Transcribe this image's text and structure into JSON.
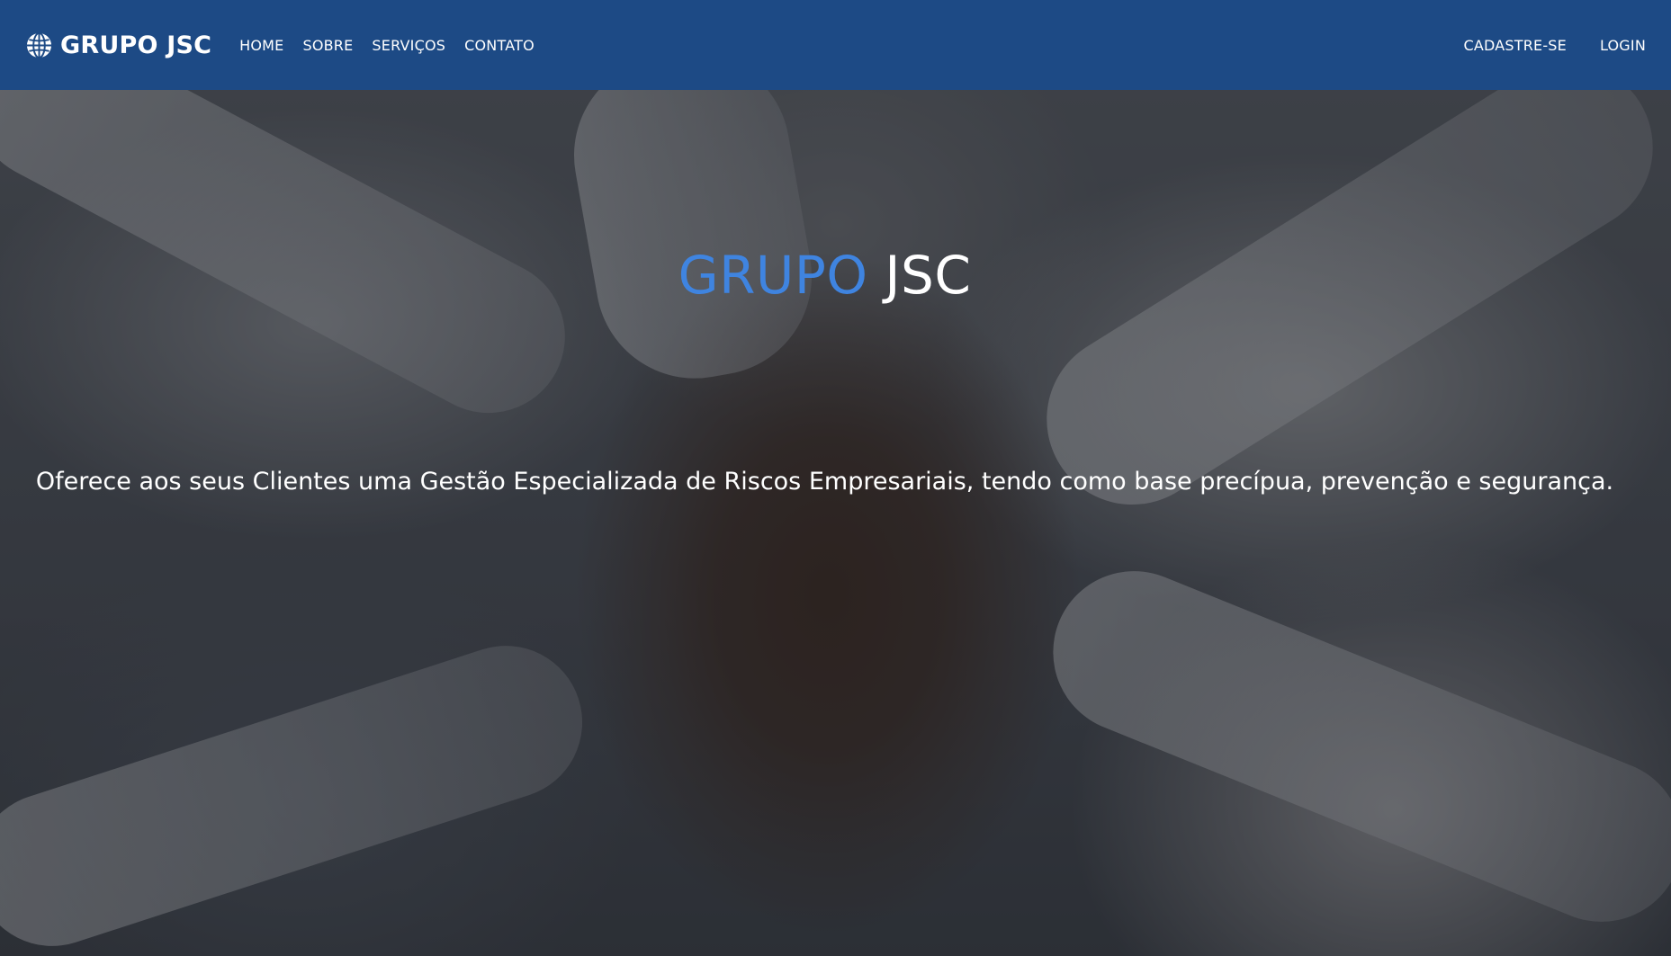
{
  "navbar": {
    "brand": "GRUPO JSC",
    "brand_icon": "globe-icon",
    "left_links": [
      "HOME",
      "SOBRE",
      "SERVIÇOS",
      "CONTATO"
    ],
    "right_links": [
      "CADASTRE-SE",
      "LOGIN"
    ],
    "background_color": "#1d4a85"
  },
  "hero": {
    "title_accent": "GRUPO",
    "title_plain": "JSC",
    "title_accent_color": "#3f84e0",
    "subtitle": "Oferece aos seus Clientes uma Gestão Especializada de Riscos Empresariais, tendo como base precípua, prevenção e segurança.",
    "background_image": "team-hands-stacked-photo"
  }
}
